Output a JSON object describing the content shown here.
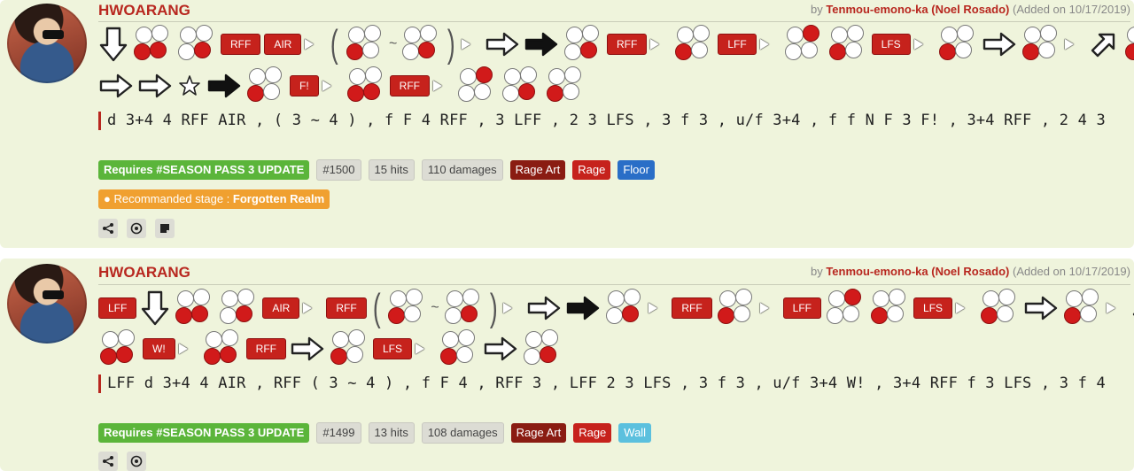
{
  "combos": [
    {
      "character": "HWOARANG",
      "author_prefix": "by",
      "author": "Tenmou-emono-ka (Noel Rosado)",
      "added": "(Added on 10/17/2019)",
      "tags_row1": [
        "RFF",
        "AIR",
        "RFF",
        "LFF",
        "LFS"
      ],
      "tags_row2": [
        "F!",
        "RFF"
      ],
      "notation": "d 3+4 4 RFF AIR , ( 3 ~ 4 ) , f F 4 RFF , 3 LFF , 2 3 LFS , 3 f 3 , u/f 3+4 , f f N F 3 F! , 3+4 RFF , 2 4 3",
      "badges": {
        "requires": "Requires #SEASON PASS 3 UPDATE",
        "id": "#1500",
        "hits": "15 hits",
        "damage": "110 damages",
        "rage_art": "Rage Art",
        "rage": "Rage",
        "surface": "Floor"
      },
      "stage_prefix": "Recommanded stage :",
      "stage": "Forgotten Realm"
    },
    {
      "character": "HWOARANG",
      "author_prefix": "by",
      "author": "Tenmou-emono-ka (Noel Rosado)",
      "added": "(Added on 10/17/2019)",
      "tags_row1": [
        "LFF",
        "AIR",
        "RFF",
        "RFF",
        "LFF",
        "LFS"
      ],
      "tags_row2": [
        "W!",
        "RFF",
        "LFS"
      ],
      "notation": "LFF d 3+4 4 AIR , RFF ( 3 ~ 4 ) , f F 4 , RFF 3 , LFF 2 3 LFS , 3 f 3 , u/f 3+4 W! , 3+4 RFF f 3 LFS , 3 f 4",
      "badges": {
        "requires": "Requires #SEASON PASS 3 UPDATE",
        "id": "#1499",
        "hits": "13 hits",
        "damage": "108 damages",
        "rage_art": "Rage Art",
        "rage": "Rage",
        "surface": "Wall"
      }
    }
  ],
  "icons": [
    "down-arrow-icon",
    "forward-arrow-icon",
    "dash-arrow-icon",
    "up-forward-arrow-icon",
    "star-icon",
    "share-icon",
    "target-icon",
    "note-icon",
    "location-pin-icon"
  ],
  "colors": {
    "card_bg": "#eff4dc",
    "accent_red": "#c6221c",
    "name_red": "#b8271f",
    "green": "#5bb53a",
    "stage_orange": "#f0a030",
    "floor_blue": "#2a6ec7",
    "wall_blue": "#5bc0de"
  }
}
